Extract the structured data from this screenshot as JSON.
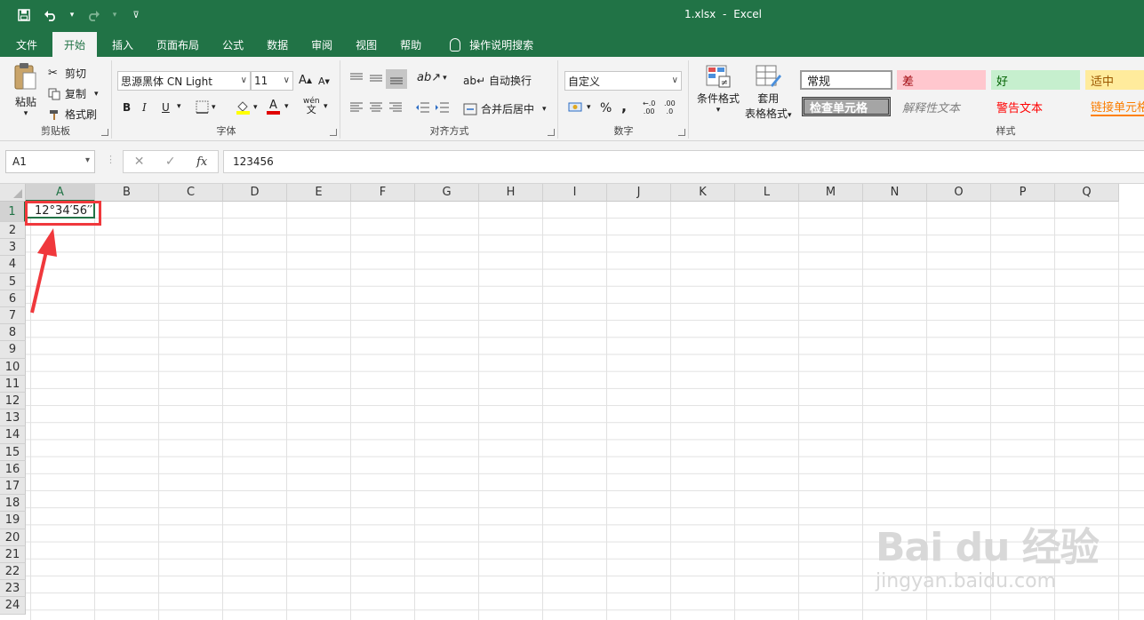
{
  "window": {
    "filename": "1.xlsx",
    "separator": "-",
    "app": "Excel"
  },
  "qat": {
    "save_icon": "save-icon",
    "undo_icon": "undo-icon",
    "redo_icon": "redo-icon",
    "customize_icon": "customize-icon"
  },
  "tabs": [
    {
      "label": "文件",
      "active": false
    },
    {
      "label": "开始",
      "active": true
    },
    {
      "label": "插入",
      "active": false
    },
    {
      "label": "页面布局",
      "active": false
    },
    {
      "label": "公式",
      "active": false
    },
    {
      "label": "数据",
      "active": false
    },
    {
      "label": "审阅",
      "active": false
    },
    {
      "label": "视图",
      "active": false
    },
    {
      "label": "帮助",
      "active": false
    }
  ],
  "tell_me": "操作说明搜索",
  "ribbon": {
    "clipboard": {
      "label": "剪贴板",
      "paste": "粘贴",
      "cut": "剪切",
      "copy": "复制",
      "format_painter": "格式刷"
    },
    "font": {
      "label": "字体",
      "font_name": "思源黑体 CN Light",
      "font_size": "11",
      "bold": "B",
      "italic": "I",
      "underline": "U",
      "grow": "A",
      "shrink": "A",
      "color_letter": "A",
      "phonetic": "wén"
    },
    "alignment": {
      "label": "对齐方式",
      "wrap": "自动换行",
      "merge": "合并后居中"
    },
    "number": {
      "label": "数字",
      "format": "自定义",
      "percent": "%",
      "comma": ",",
      "inc_decimal": ".00",
      "dec_decimal": ".0"
    },
    "styles_group": {
      "label": "样式",
      "conditional": "条件格式",
      "table_l1": "套用",
      "table_l2": "表格格式",
      "cells": [
        {
          "text": "常规"
        },
        {
          "text": "差"
        },
        {
          "text": "好"
        },
        {
          "text": "适中"
        },
        {
          "text": "检查单元格"
        },
        {
          "text": "解释性文本"
        },
        {
          "text": "警告文本"
        },
        {
          "text": "链接单元格"
        }
      ]
    }
  },
  "formula_bar": {
    "name_box": "A1",
    "cancel": "✕",
    "enter": "✓",
    "fx": "fx",
    "content": "123456"
  },
  "sheet": {
    "columns": [
      "A",
      "B",
      "C",
      "D",
      "E",
      "F",
      "G",
      "H",
      "I",
      "J",
      "K",
      "L",
      "M",
      "N",
      "O",
      "P",
      "Q"
    ],
    "rows": [
      "1",
      "2",
      "3",
      "4",
      "5",
      "6",
      "7",
      "8",
      "9",
      "10",
      "11",
      "12",
      "13",
      "14",
      "15",
      "16",
      "17",
      "18",
      "19",
      "20",
      "21",
      "22",
      "23",
      "24"
    ],
    "active_cell_display": "12°34′56′′"
  },
  "watermark": {
    "brand": "Bai du 经验",
    "url": "jingyan.baidu.com"
  },
  "colors": {
    "excel_green": "#217346",
    "highlight_red": "#f0383c"
  }
}
